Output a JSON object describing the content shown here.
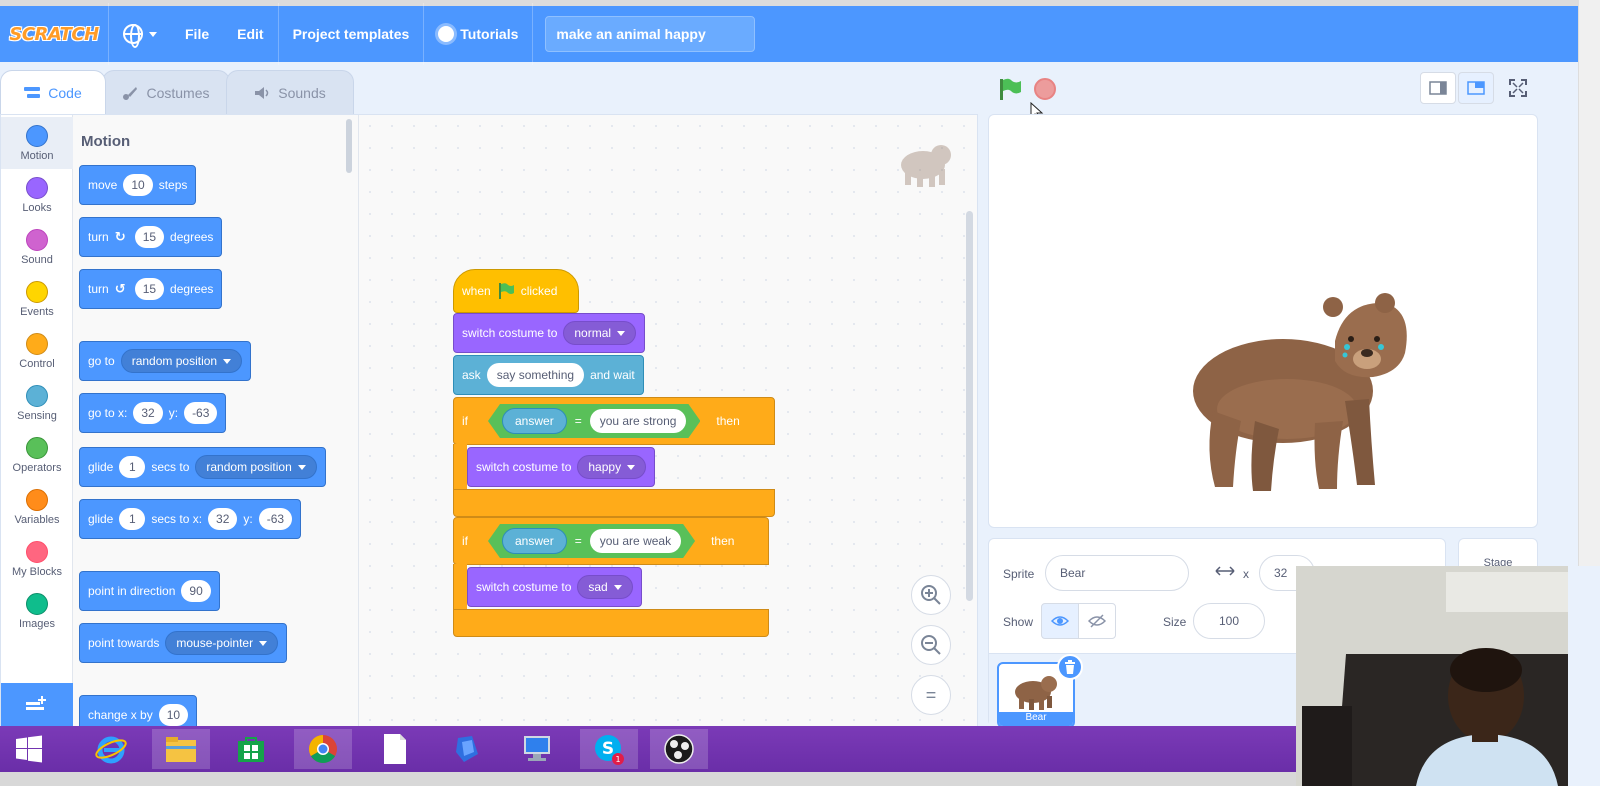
{
  "menubar": {
    "logo": "SCRATCH",
    "file": "File",
    "edit": "Edit",
    "templates": "Project templates",
    "tutorials": "Tutorials",
    "project_title": "make an animal happy"
  },
  "tabs": {
    "code": "Code",
    "costumes": "Costumes",
    "sounds": "Sounds"
  },
  "categories": [
    {
      "label": "Motion",
      "color": "#4c97ff"
    },
    {
      "label": "Looks",
      "color": "#9966ff"
    },
    {
      "label": "Sound",
      "color": "#cf63cf"
    },
    {
      "label": "Events",
      "color": "#ffd500"
    },
    {
      "label": "Control",
      "color": "#ffab19"
    },
    {
      "label": "Sensing",
      "color": "#5cb1d6"
    },
    {
      "label": "Operators",
      "color": "#59c059"
    },
    {
      "label": "Variables",
      "color": "#ff8c1a"
    },
    {
      "label": "My Blocks",
      "color": "#ff6680"
    },
    {
      "label": "Images",
      "color": "#0fbd8c"
    }
  ],
  "palette": {
    "title": "Motion",
    "move": {
      "label": "move",
      "value": "10",
      "suffix": "steps"
    },
    "turn_right": {
      "label": "turn",
      "value": "15",
      "suffix": "degrees"
    },
    "turn_left": {
      "label": "turn",
      "value": "15",
      "suffix": "degrees"
    },
    "goto": {
      "label": "go to",
      "option": "random position"
    },
    "goto_xy": {
      "label": "go to x:",
      "x": "32",
      "ylabel": "y:",
      "y": "-63"
    },
    "glide": {
      "label": "glide",
      "value": "1",
      "mid": "secs to",
      "option": "random position"
    },
    "glide_xy": {
      "label": "glide",
      "value": "1",
      "mid": "secs to x:",
      "x": "32",
      "ylabel": "y:",
      "y": "-63"
    },
    "point_dir": {
      "label": "point in direction",
      "value": "90"
    },
    "point_towards": {
      "label": "point towards",
      "option": "mouse-pointer"
    },
    "change_x": {
      "label": "change x by",
      "value": "10"
    }
  },
  "script": {
    "hat": {
      "when": "when",
      "clicked": "clicked"
    },
    "costume1": {
      "label": "switch costume to",
      "option": "normal"
    },
    "ask": {
      "label": "ask",
      "value": "say something",
      "suffix": "and wait"
    },
    "if1": {
      "if": "if",
      "reporter": "answer",
      "op": "=",
      "value": "you are strong",
      "then": "then"
    },
    "costume2": {
      "label": "switch costume to",
      "option": "happy"
    },
    "if2": {
      "if": "if",
      "reporter": "answer",
      "op": "=",
      "value": "you are weak",
      "then": "then"
    },
    "costume3": {
      "label": "switch costume to",
      "option": "sad"
    }
  },
  "zoom": {
    "in": "+",
    "out": "−",
    "reset": "="
  },
  "sprite_info": {
    "sprite_label": "Sprite",
    "sprite_name": "Bear",
    "x_label": "x",
    "x_value": "32",
    "show_label": "Show",
    "size_label": "Size",
    "size_value": "100",
    "thumb_name": "Bear"
  },
  "stage_pane": {
    "label": "Stage"
  }
}
